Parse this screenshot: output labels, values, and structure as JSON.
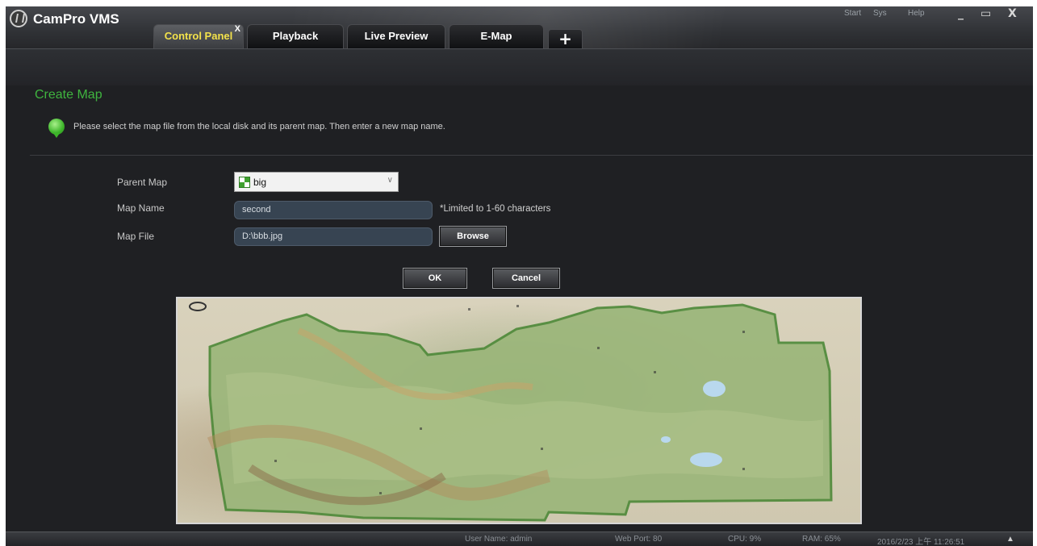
{
  "app": {
    "title": "CamPro VMS"
  },
  "topmenu": {
    "start": "Start",
    "sys": "Sys",
    "help": "Help"
  },
  "window_controls": {
    "minimize": "_",
    "maximize": "▭",
    "close": "X"
  },
  "tabs": [
    {
      "label": "Control Panel",
      "active": true,
      "close": "X"
    },
    {
      "label": "Playback",
      "active": false
    },
    {
      "label": "Live Preview",
      "active": false
    },
    {
      "label": "E-Map",
      "active": false
    }
  ],
  "add_tab": "+",
  "page": {
    "title": "Create Map",
    "info": "Please select the map file from the local disk and its parent map. Then enter a new map name."
  },
  "form": {
    "parent_map_label": "Parent Map",
    "parent_map_value": "big",
    "map_name_label": "Map Name",
    "map_name_value": "second",
    "map_name_hint": "*Limited to 1-60 characters",
    "map_file_label": "Map File",
    "map_file_value": "D:\\bbb.jpg",
    "browse": "Browse",
    "ok": "OK",
    "cancel": "Cancel"
  },
  "status": {
    "user": "User Name: admin",
    "port": "Web Port: 80",
    "cpu": "CPU: 9%",
    "ram": "RAM: 65%",
    "datetime": "2016/2/23 上午 11:26:51",
    "arrow": "▲"
  },
  "colors": {
    "accent_green": "#3fb43f",
    "active_tab_text": "#f3e24b"
  },
  "icons": [
    "app-logo-icon",
    "info-bubble-icon",
    "map-tree-icon",
    "chevron-down-icon"
  ]
}
